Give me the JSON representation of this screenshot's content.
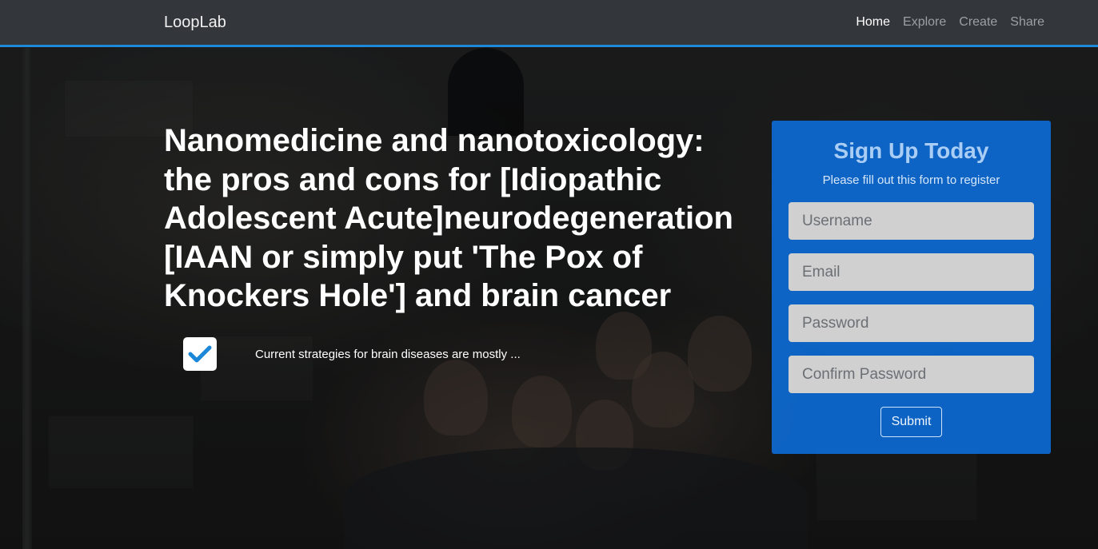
{
  "navbar": {
    "brand": "LoopLab",
    "links": [
      {
        "label": "Home",
        "active": true
      },
      {
        "label": "Explore",
        "active": false
      },
      {
        "label": "Create",
        "active": false
      },
      {
        "label": "Share",
        "active": false
      }
    ],
    "accent_color": "#1e88d9"
  },
  "hero": {
    "title": "Nanomedicine and nanotoxicology: the pros and cons for [Idiopathic Adolescent Acute]neurodegeneration [IAAN or simply put 'The Pox of Knockers Hole'] and brain cancer",
    "feature": {
      "icon": "checkmark-icon",
      "text": "Current strategies for brain diseases are mostly ..."
    }
  },
  "signup": {
    "title": "Sign Up Today",
    "subtitle": "Please fill out this form to register",
    "fields": {
      "username_placeholder": "Username",
      "email_placeholder": "Email",
      "password_placeholder": "Password",
      "confirm_password_placeholder": "Confirm Password"
    },
    "submit_label": "Submit",
    "card_color": "#0d6edc"
  }
}
